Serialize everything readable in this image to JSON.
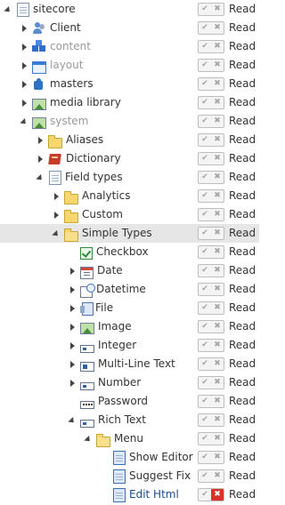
{
  "tree": [
    {
      "label": "sitecore",
      "level": 0,
      "expander": "open",
      "icon": "page-icon",
      "muted": false,
      "permission": "Read",
      "allow_icon": "✔",
      "deny_icon": "✖",
      "deny_active": false
    },
    {
      "label": "Client",
      "level": 1,
      "expander": "closed",
      "icon": "people-icon",
      "muted": false,
      "permission": "Read",
      "allow_icon": "✔",
      "deny_icon": "✖",
      "deny_active": false
    },
    {
      "label": "content",
      "level": 1,
      "expander": "closed",
      "icon": "cubes-icon",
      "muted": true,
      "permission": "Read",
      "allow_icon": "✔",
      "deny_icon": "✖",
      "deny_active": false
    },
    {
      "label": "layout",
      "level": 1,
      "expander": "closed",
      "icon": "window-icon",
      "muted": true,
      "permission": "Read",
      "allow_icon": "✔",
      "deny_icon": "✖",
      "deny_active": false
    },
    {
      "label": "masters",
      "level": 1,
      "expander": "closed",
      "icon": "puzzle-icon",
      "muted": false,
      "permission": "Read",
      "allow_icon": "✔",
      "deny_icon": "✖",
      "deny_active": false
    },
    {
      "label": "media library",
      "level": 1,
      "expander": "closed",
      "icon": "image-icon",
      "muted": false,
      "permission": "Read",
      "allow_icon": "✔",
      "deny_icon": "✖",
      "deny_active": false
    },
    {
      "label": "system",
      "level": 1,
      "expander": "open",
      "icon": "image-icon",
      "muted": true,
      "permission": "Read",
      "allow_icon": "✔",
      "deny_icon": "✖",
      "deny_active": false
    },
    {
      "label": "Aliases",
      "level": 2,
      "expander": "closed",
      "icon": "folder-icon",
      "muted": false,
      "permission": "Read",
      "allow_icon": "✔",
      "deny_icon": "✖",
      "deny_active": false
    },
    {
      "label": "Dictionary",
      "level": 2,
      "expander": "closed",
      "icon": "book-icon",
      "muted": false,
      "permission": "Read",
      "allow_icon": "✔",
      "deny_icon": "✖",
      "deny_active": false
    },
    {
      "label": "Field types",
      "level": 2,
      "expander": "open",
      "icon": "page-icon",
      "muted": false,
      "permission": "Read",
      "allow_icon": "✔",
      "deny_icon": "✖",
      "deny_active": false
    },
    {
      "label": "Analytics",
      "level": 3,
      "expander": "closed",
      "icon": "folder-icon",
      "muted": false,
      "permission": "Read",
      "allow_icon": "✔",
      "deny_icon": "✖",
      "deny_active": false
    },
    {
      "label": "Custom",
      "level": 3,
      "expander": "closed",
      "icon": "folder-icon",
      "muted": false,
      "permission": "Read",
      "allow_icon": "✔",
      "deny_icon": "✖",
      "deny_active": false
    },
    {
      "label": "Simple Types",
      "level": 3,
      "expander": "open",
      "icon": "folder-open-icon",
      "muted": false,
      "selected": true,
      "permission": "Read",
      "allow_icon": "✔",
      "deny_icon": "✖",
      "deny_active": false
    },
    {
      "label": "Checkbox",
      "level": 4,
      "expander": "none",
      "icon": "checkbox-icon",
      "muted": false,
      "permission": "Read",
      "allow_icon": "✔",
      "deny_icon": "✖",
      "deny_active": false
    },
    {
      "label": "Date",
      "level": 4,
      "expander": "closed",
      "icon": "calendar-icon",
      "muted": false,
      "permission": "Read",
      "allow_icon": "✔",
      "deny_icon": "✖",
      "deny_active": false
    },
    {
      "label": "Datetime",
      "level": 4,
      "expander": "closed",
      "icon": "calendar-clock-icon",
      "muted": false,
      "permission": "Read",
      "allow_icon": "✔",
      "deny_icon": "✖",
      "deny_active": false
    },
    {
      "label": "File",
      "level": 4,
      "expander": "closed",
      "icon": "file-icon",
      "muted": false,
      "permission": "Read",
      "allow_icon": "✔",
      "deny_icon": "✖",
      "deny_active": false
    },
    {
      "label": "Image",
      "level": 4,
      "expander": "closed",
      "icon": "image-icon",
      "muted": false,
      "permission": "Read",
      "allow_icon": "✔",
      "deny_icon": "✖",
      "deny_active": false
    },
    {
      "label": "Integer",
      "level": 4,
      "expander": "closed",
      "icon": "field-icon",
      "muted": false,
      "permission": "Read",
      "allow_icon": "✔",
      "deny_icon": "✖",
      "deny_active": false
    },
    {
      "label": "Multi-Line Text",
      "level": 4,
      "expander": "closed",
      "icon": "textarea-icon",
      "muted": false,
      "permission": "Read",
      "allow_icon": "✔",
      "deny_icon": "✖",
      "deny_active": false
    },
    {
      "label": "Number",
      "level": 4,
      "expander": "closed",
      "icon": "field-icon",
      "muted": false,
      "permission": "Read",
      "allow_icon": "✔",
      "deny_icon": "✖",
      "deny_active": false
    },
    {
      "label": "Password",
      "level": 4,
      "expander": "none",
      "icon": "password-icon",
      "muted": false,
      "permission": "Read",
      "allow_icon": "✔",
      "deny_icon": "✖",
      "deny_active": false
    },
    {
      "label": "Rich Text",
      "level": 4,
      "expander": "open",
      "icon": "field-icon",
      "muted": false,
      "permission": "Read",
      "allow_icon": "✔",
      "deny_icon": "✖",
      "deny_active": false
    },
    {
      "label": "Menu",
      "level": 5,
      "expander": "open",
      "icon": "folder-open-icon",
      "muted": false,
      "permission": "Read",
      "allow_icon": "✔",
      "deny_icon": "✖",
      "deny_active": false
    },
    {
      "label": "Show Editor",
      "level": 6,
      "expander": "none",
      "icon": "page-blue-icon",
      "muted": false,
      "permission": "Read",
      "allow_icon": "✔",
      "deny_icon": "✖",
      "deny_active": false
    },
    {
      "label": "Suggest Fix",
      "level": 6,
      "expander": "none",
      "icon": "page-blue-icon",
      "muted": false,
      "permission": "Read",
      "allow_icon": "✔",
      "deny_icon": "✖",
      "deny_active": false
    },
    {
      "label": "Edit Html",
      "level": 6,
      "expander": "none",
      "icon": "page-blue-icon",
      "muted": false,
      "highlight": true,
      "permission": "Read",
      "allow_icon": "✔",
      "deny_icon": "✖",
      "deny_active": true
    }
  ],
  "colors": {
    "deny_active": "#d9342b",
    "selected_row": "#e6e6e6",
    "muted_text": "#9a9a9a"
  }
}
